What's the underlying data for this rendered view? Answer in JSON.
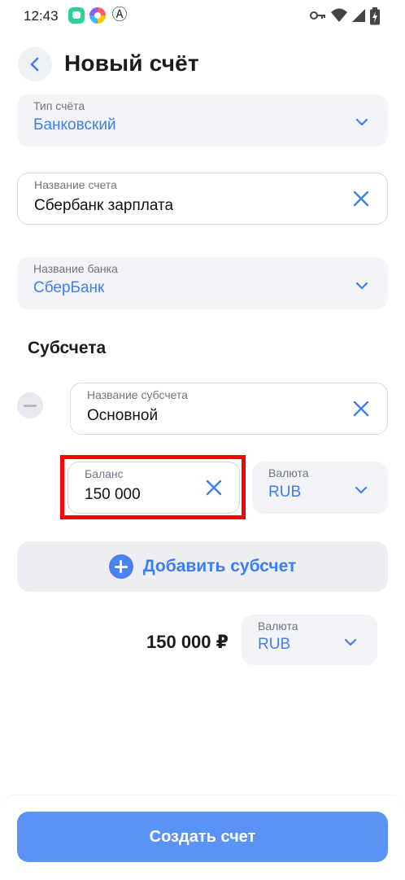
{
  "status_bar": {
    "time": "12:43",
    "app_icons": [
      "chat-app-icon",
      "pie-app-icon",
      "anarchy-icon"
    ],
    "system_icons": [
      "key-icon",
      "wifi-icon",
      "signal-icon",
      "battery-charging-icon"
    ]
  },
  "header": {
    "title": "Новый счёт",
    "back_icon": "chevron-left-icon"
  },
  "account_type": {
    "label": "Тип счёта",
    "value": "Банковский"
  },
  "account_name": {
    "label": "Название счета",
    "value": "Сбербанк зарплата"
  },
  "bank_name": {
    "label": "Название банка",
    "value": "СберБанк"
  },
  "subaccounts": {
    "title": "Субсчета",
    "items": [
      {
        "name_label": "Название субсчета",
        "name_value": "Основной",
        "balance_label": "Баланс",
        "balance_value": "150 000",
        "currency_label": "Валюта",
        "currency_value": "RUB"
      }
    ],
    "add_label": "Добавить субсчет"
  },
  "total": {
    "amount": "150 000 ₽",
    "currency_label": "Валюта",
    "currency_value": "RUB"
  },
  "submit": {
    "label": "Создать счет"
  },
  "colors": {
    "accent": "#3e7ef2",
    "button": "#5b92f5",
    "highlight": "#ff0000"
  }
}
